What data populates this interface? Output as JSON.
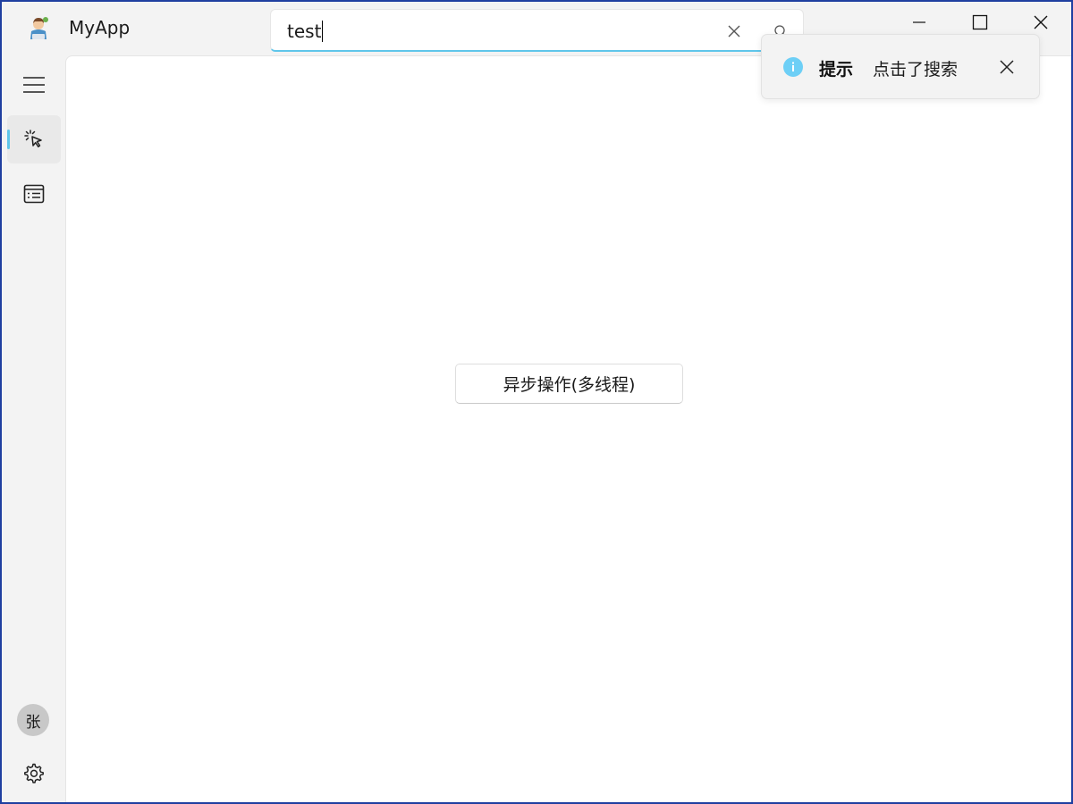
{
  "app": {
    "title": "MyApp"
  },
  "search": {
    "value": "test"
  },
  "sidebar": {
    "avatar_text": "张",
    "items": [
      {
        "icon": "hamburger-menu-icon"
      },
      {
        "icon": "cursor-click-icon",
        "active": true
      },
      {
        "icon": "list-icon"
      }
    ]
  },
  "main": {
    "async_button_label": "异步操作(多线程)"
  },
  "toast": {
    "title": "提示",
    "message": "点击了搜索"
  },
  "colors": {
    "accent": "#5fc6ea",
    "info": "#6dcff6"
  }
}
